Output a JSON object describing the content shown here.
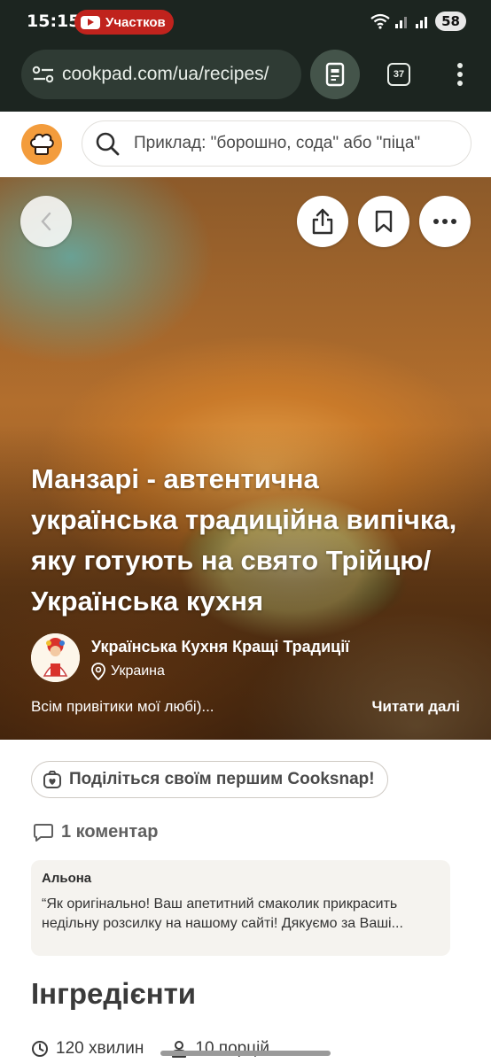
{
  "status_bar": {
    "time": "15:15",
    "notification_text": "Участков",
    "battery": "58"
  },
  "browser": {
    "url": "cookpad.com/ua/recipes/",
    "tab_count": "37"
  },
  "site": {
    "search_placeholder": "Приклад: \"борошно, сода\" або \"піца\""
  },
  "recipe": {
    "title": "Манзарі - автентична українська традиційна випічка, яку готують на свято Трійцю/Українська кухня",
    "author_name": "Українська Кухня Кращі Традиції",
    "author_location": "Украина",
    "story_excerpt": "Всім привітики мої любі)...",
    "read_more": "Читати далі"
  },
  "cooksnap": {
    "label": "Поділіться своїм першим Cooksnap!"
  },
  "comments": {
    "header": "1 коментар",
    "items": [
      {
        "author": "Альона",
        "text": "“Як оригінально! Ваш апетитний смаколик прикрасить недільну розсилку на нашому сайті! Дякуємо за Ваші..."
      }
    ]
  },
  "ingredients": {
    "title": "Інгредієнти",
    "time": "120 хвилин",
    "servings": "10 порцій"
  },
  "colors": {
    "brand_orange": "#f39c3c",
    "browser_bg": "#1c2520",
    "notification_red": "#c0231d"
  }
}
